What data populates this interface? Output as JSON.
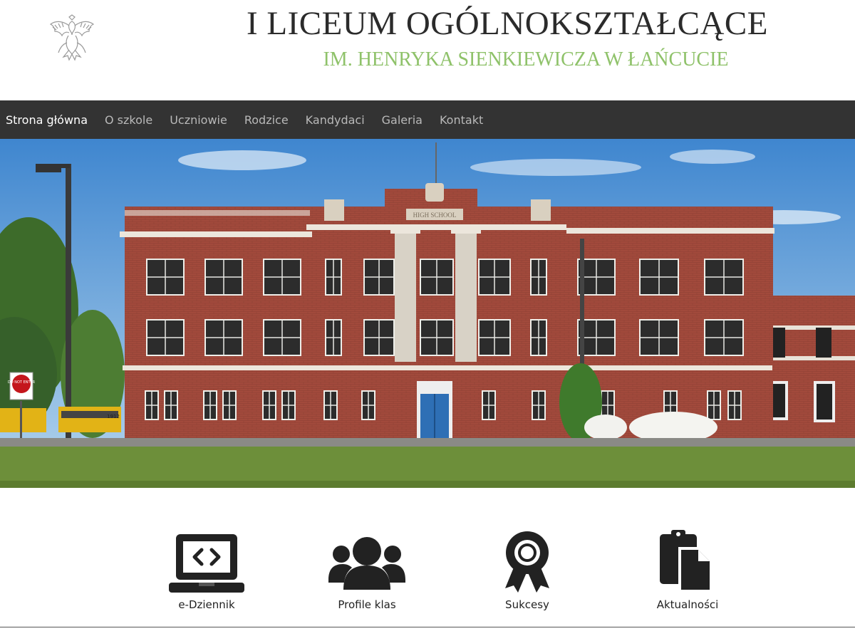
{
  "header": {
    "emblem_icon": "polish-eagle-emblem-icon",
    "title": "I LICEUM OGÓLNOKSZTAŁCĄCE",
    "subtitle": "IM. HENRYKA SIENKIEWICZA W ŁAŃCUCIE"
  },
  "nav": {
    "items": [
      {
        "label": "Strona główna",
        "active": true
      },
      {
        "label": "O szkole",
        "active": false
      },
      {
        "label": "Uczniowie",
        "active": false
      },
      {
        "label": "Rodzice",
        "active": false
      },
      {
        "label": "Kandydaci",
        "active": false
      },
      {
        "label": "Galeria",
        "active": false
      },
      {
        "label": "Kontakt",
        "active": false
      }
    ]
  },
  "hero": {
    "building_sign": "HIGH SCHOOL",
    "stop_sign": "DO NOT ENTER",
    "bus_number": "1912"
  },
  "tiles": [
    {
      "label": "e-Dziennik",
      "icon": "laptop-code-icon"
    },
    {
      "label": "Profile klas",
      "icon": "users-group-icon"
    },
    {
      "label": "Sukcesy",
      "icon": "award-ribbon-icon"
    },
    {
      "label": "Aktualności",
      "icon": "clipboard-document-icon"
    }
  ],
  "colors": {
    "nav_bg": "#333333",
    "subtitle": "#8fc26a",
    "brick": "#a24a3c",
    "sky": "#5fa3dc",
    "grass": "#6d8f3a"
  }
}
